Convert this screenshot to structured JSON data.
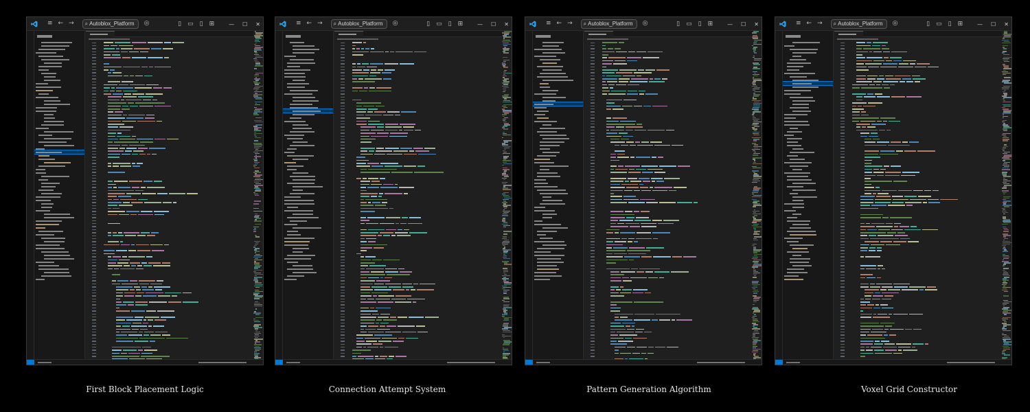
{
  "app": {
    "search_text": "Autoblox_Platform",
    "accent_color": "#0078d4",
    "icons": [
      "vscode-logo-icon",
      "menu-icon",
      "back-arrow-icon",
      "forward-arrow-icon",
      "search-icon",
      "copilot-icon",
      "toggle-primary-sidebar-icon",
      "toggle-panel-icon",
      "toggle-secondary-sidebar-icon",
      "customize-layout-icon",
      "minimize-icon",
      "maximize-icon",
      "close-icon"
    ]
  },
  "panels": [
    {
      "caption": "First Block Placement Logic"
    },
    {
      "caption": "Connection Attempt System"
    },
    {
      "caption": "Pattern Generation Algorithm"
    },
    {
      "caption": "Voxel Grid Constructor"
    }
  ]
}
